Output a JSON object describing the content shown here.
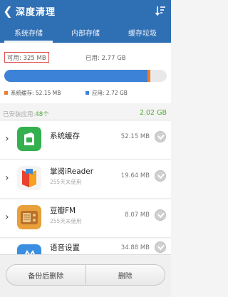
{
  "header": {
    "back_icon": "chevron-left-icon",
    "title": "深度清理",
    "sort_icon": "sort-icon"
  },
  "tabs": [
    {
      "label": "系统存储",
      "active": true
    },
    {
      "label": "内部存储",
      "active": false
    },
    {
      "label": "缓存垃圾",
      "active": false
    }
  ],
  "storage": {
    "available": "可用: 325 MB",
    "used": "已用: 2.77 GB",
    "legend_system": "系统缓存: 52.15 MB",
    "legend_apps": "应用: 2.72 GB",
    "colors": {
      "apps": "#3c82d7",
      "system": "#ee7a2e",
      "free": "#e9e9e9"
    },
    "apps_fraction": 0.88,
    "system_fraction": 0.02
  },
  "installed": {
    "label": "已安装应用:",
    "count": "48个",
    "total": "2.02 GB"
  },
  "apps": [
    {
      "name": "系统缓存",
      "sub": "",
      "size": "52.15 MB",
      "icon": "system-cache-icon"
    },
    {
      "name": "掌阅iReader",
      "sub": "255天未使用",
      "size": "19.64 MB",
      "icon": "ireader-icon"
    },
    {
      "name": "豆瓣FM",
      "sub": "255天未使用",
      "size": "8.07 MB",
      "icon": "douban-fm-icon"
    },
    {
      "name": "语音设置",
      "sub": "",
      "size": "34.88 MB",
      "icon": "voice-settings-icon"
    }
  ],
  "buttons": {
    "backup_delete": "备份后删除",
    "delete": "删除"
  }
}
